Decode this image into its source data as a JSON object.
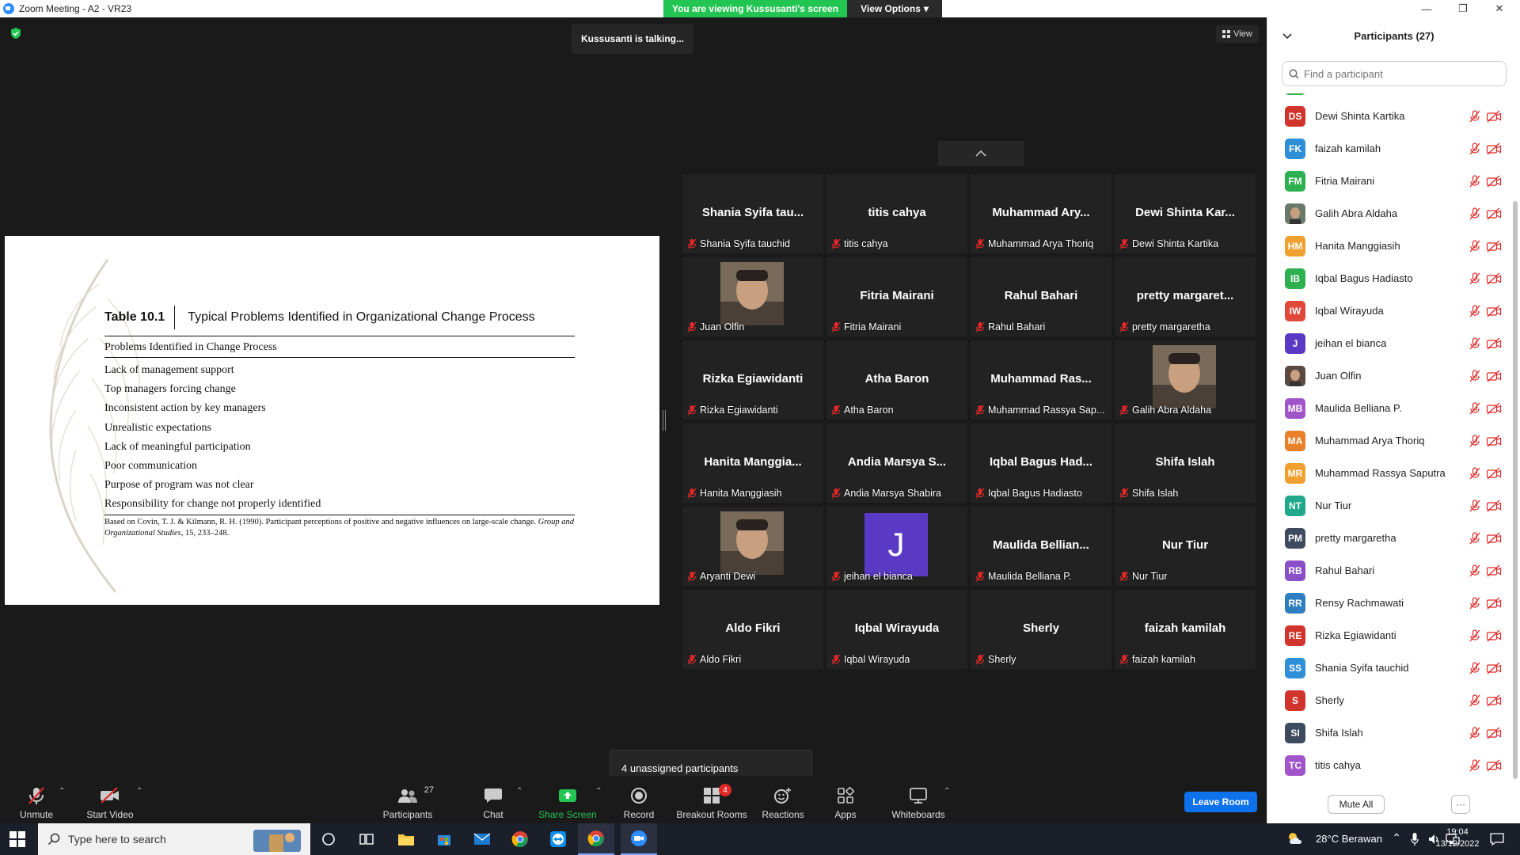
{
  "window": {
    "title": "Zoom Meeting - A2 - VR23"
  },
  "banner": {
    "viewing": "You are viewing Kussusanti's screen",
    "view_options": "View Options"
  },
  "talking": "Kussusanti is talking...",
  "view_btn": "View",
  "document": {
    "table_num": "Table 10.1",
    "table_title": "Typical Problems Identified in Organizational Change Process",
    "col_head": "Problems Identified in Change Process",
    "items": [
      "Lack of management support",
      "Top managers forcing change",
      "Inconsistent action by key managers",
      "Unrealistic expectations",
      "Lack of meaningful participation",
      "Poor communication",
      "Purpose of program was not clear",
      "Responsibility for change not properly identified"
    ],
    "footnote_a": "Based on Covin, T. J. & Kilmann, R. H. (1990). Participant perceptions of positive and negative influences on large-scale change. ",
    "footnote_journal": "Group and Organizational Studies",
    "footnote_b": ", 15, 233–248."
  },
  "gallery": [
    {
      "center": "Shania Syifa tau...",
      "foot": "Shania Syifa tauchid",
      "kind": "name"
    },
    {
      "center": "titis cahya",
      "foot": "titis cahya",
      "kind": "name"
    },
    {
      "center": "Muhammad Ary...",
      "foot": "Muhammad Arya Thoriq",
      "kind": "name"
    },
    {
      "center": "Dewi Shinta Kar...",
      "foot": "Dewi Shinta Kartika",
      "kind": "name"
    },
    {
      "center": "",
      "foot": "Juan Olfin",
      "kind": "photo"
    },
    {
      "center": "Fitria Mairani",
      "foot": "Fitria Mairani",
      "kind": "name"
    },
    {
      "center": "Rahul Bahari",
      "foot": "Rahul Bahari",
      "kind": "name"
    },
    {
      "center": "pretty margaret...",
      "foot": "pretty margaretha",
      "kind": "name"
    },
    {
      "center": "Rizka Egiawidanti",
      "foot": "Rizka Egiawidanti",
      "kind": "name"
    },
    {
      "center": "Atha Baron",
      "foot": "Atha Baron",
      "kind": "name"
    },
    {
      "center": "Muhammad Ras...",
      "foot": "Muhammad Rassya Sap...",
      "kind": "name"
    },
    {
      "center": "",
      "foot": "Galih Abra Aldaha",
      "kind": "photo"
    },
    {
      "center": "Hanita Manggia...",
      "foot": "Hanita Manggiasih",
      "kind": "name"
    },
    {
      "center": "Andia Marsya S...",
      "foot": "Andia Marsya Shabira",
      "kind": "name"
    },
    {
      "center": "Iqbal Bagus Had...",
      "foot": "Iqbal Bagus Hadiasto",
      "kind": "name"
    },
    {
      "center": "Shifa Islah",
      "foot": "Shifa Islah",
      "kind": "name"
    },
    {
      "center": "",
      "foot": "Aryanti Dewi",
      "kind": "photo"
    },
    {
      "center": "J",
      "foot": "jeihan el bianca",
      "kind": "letter"
    },
    {
      "center": "Maulida Bellian...",
      "foot": "Maulida Belliana P.",
      "kind": "name"
    },
    {
      "center": "Nur Tiur",
      "foot": "Nur Tiur",
      "kind": "name"
    },
    {
      "center": "Aldo Fikri",
      "foot": "Aldo Fikri",
      "kind": "name"
    },
    {
      "center": "Iqbal Wirayuda",
      "foot": "Iqbal Wirayuda",
      "kind": "name"
    },
    {
      "center": "Sherly",
      "foot": "Sherly",
      "kind": "name"
    },
    {
      "center": "faizah kamilah",
      "foot": "faizah kamilah",
      "kind": "name"
    }
  ],
  "unassigned": "4 unassigned participants",
  "toolbar": {
    "unmute": "Unmute",
    "start_video": "Start Video",
    "participants": "Participants",
    "participants_count": "27",
    "chat": "Chat",
    "share_screen": "Share Screen",
    "record": "Record",
    "breakout_rooms": "Breakout Rooms",
    "breakout_badge": "4",
    "reactions": "Reactions",
    "apps": "Apps",
    "whiteboards": "Whiteboards",
    "leave_room": "Leave Room"
  },
  "panel": {
    "title": "Participants (27)",
    "search_placeholder": "Find a participant",
    "mute_all": "Mute All",
    "more": "···",
    "participants": [
      {
        "initials": "DS",
        "name": "Dewi Shinta Kartika",
        "color": "#d0342c"
      },
      {
        "initials": "FK",
        "name": "faizah kamilah",
        "color": "#2f8fd6"
      },
      {
        "initials": "FM",
        "name": "Fitria Mairani",
        "color": "#2fb050"
      },
      {
        "initials": "",
        "name": "Galih Abra Aldaha",
        "color": "#6a7a6a"
      },
      {
        "initials": "HM",
        "name": "Hanita Manggiasih",
        "color": "#f0a030"
      },
      {
        "initials": "IB",
        "name": "Iqbal Bagus Hadiasto",
        "color": "#2fb050"
      },
      {
        "initials": "IW",
        "name": "Iqbal Wirayuda",
        "color": "#e0483a"
      },
      {
        "initials": "J",
        "name": "jeihan el bianca",
        "color": "#5a39c4"
      },
      {
        "initials": "",
        "name": "Juan Olfin",
        "color": "#5a4a40"
      },
      {
        "initials": "MB",
        "name": "Maulida Belliana P.",
        "color": "#a056c8"
      },
      {
        "initials": "MA",
        "name": "Muhammad Arya Thoriq",
        "color": "#e8812a"
      },
      {
        "initials": "MR",
        "name": "Muhammad Rassya Saputra",
        "color": "#f0a030"
      },
      {
        "initials": "NT",
        "name": "Nur Tiur",
        "color": "#1fa88a"
      },
      {
        "initials": "PM",
        "name": "pretty margaretha",
        "color": "#3e4a5e"
      },
      {
        "initials": "RB",
        "name": "Rahul Bahari",
        "color": "#8a4fc8"
      },
      {
        "initials": "RR",
        "name": "Rensy Rachmawati",
        "color": "#2f7fc0"
      },
      {
        "initials": "RE",
        "name": "Rizka Egiawidanti",
        "color": "#d0342c"
      },
      {
        "initials": "SS",
        "name": "Shania Syifa tauchid",
        "color": "#2f8fd6"
      },
      {
        "initials": "S",
        "name": "Sherly",
        "color": "#d0342c"
      },
      {
        "initials": "SI",
        "name": "Shifa Islah",
        "color": "#3e4a5e"
      },
      {
        "initials": "TC",
        "name": "titis cahya",
        "color": "#a056c8"
      }
    ]
  },
  "taskbar": {
    "search_placeholder": "Type here to search",
    "weather": "28°C  Berawan",
    "time": "19:04",
    "date": "13/12/2022"
  }
}
